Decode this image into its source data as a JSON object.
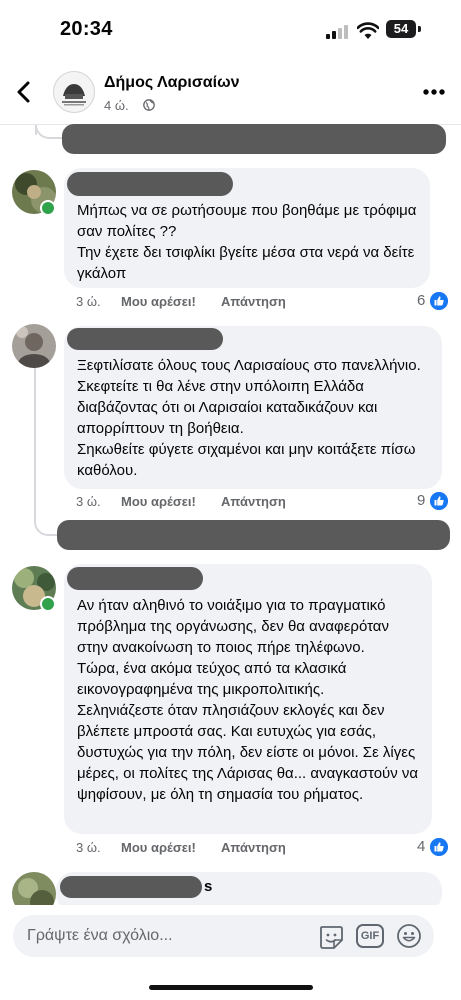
{
  "status_bar": {
    "time": "20:34",
    "battery": "54"
  },
  "header": {
    "page_name": "Δήμος Λαρισαίων",
    "post_time": "4 ώ."
  },
  "comments": [
    {
      "text": "Μήπως να σε ρωτήσουμε που βοηθάμε με τρόφιμα σαν πολίτες ??\nΤην έχετε δει τσιφλίκι βγείτε μέσα στα νερά να δείτε γκάλοπ",
      "time": "3 ώ.",
      "like_label": "Μου αρέσει!",
      "reply_label": "Απάντηση",
      "reactions": "6"
    },
    {
      "text": "Ξεφτιλίσατε όλους τους Λαρισαίους στο πανελλήνιο. Σκεφτείτε τι θα λένε στην υπόλοιπη Ελλάδα διαβάζοντας ότι οι Λαρισαίοι καταδικάζουν και απορρίπτουν τη βοήθεια.\nΣηκωθείτε φύγετε σιχαμένοι και μην κοιτάξετε πίσω καθόλου.",
      "time": "3 ώ.",
      "like_label": "Μου αρέσει!",
      "reply_label": "Απάντηση",
      "reactions": "9"
    },
    {
      "text": "Αν ήταν αληθινό το νοιάξιμο για το πραγματικό πρόβλημα της οργάνωσης, δεν θα αναφερόταν στην ανακοίνωση το ποιος πήρε τηλέφωνο.\nΤώρα, ένα ακόμα τεύχος από τα κλασικά εικονογραφημένα της μικροπολιτικής.\nΣεληνιάζεστε όταν πλησιάζουν εκλογές και δεν βλέπετε μπροστά σας. Και ευτυχώς για εσάς, δυστυχώς για την πόλη, δεν είστε οι μόνοι. Σε λίγες μέρες, οι πολίτες της Λάρισας θα... αναγκαστούν να ψηφίσουν, με όλη τη σημασία του ρήματος.",
      "time": "3 ώ.",
      "like_label": "Μου αρέσει!",
      "reply_label": "Απάντηση",
      "reactions": "4"
    }
  ],
  "partial_comment": {
    "name_tail": "s"
  },
  "composer": {
    "placeholder": "Γράψτε ένα σχόλιο...",
    "gif_label": "GIF"
  },
  "icons": [
    "cellular-icon",
    "wifi-icon",
    "back-icon",
    "globe-icon",
    "more-icon",
    "like-icon",
    "sticker-icon",
    "gif-icon",
    "emoji-icon"
  ]
}
